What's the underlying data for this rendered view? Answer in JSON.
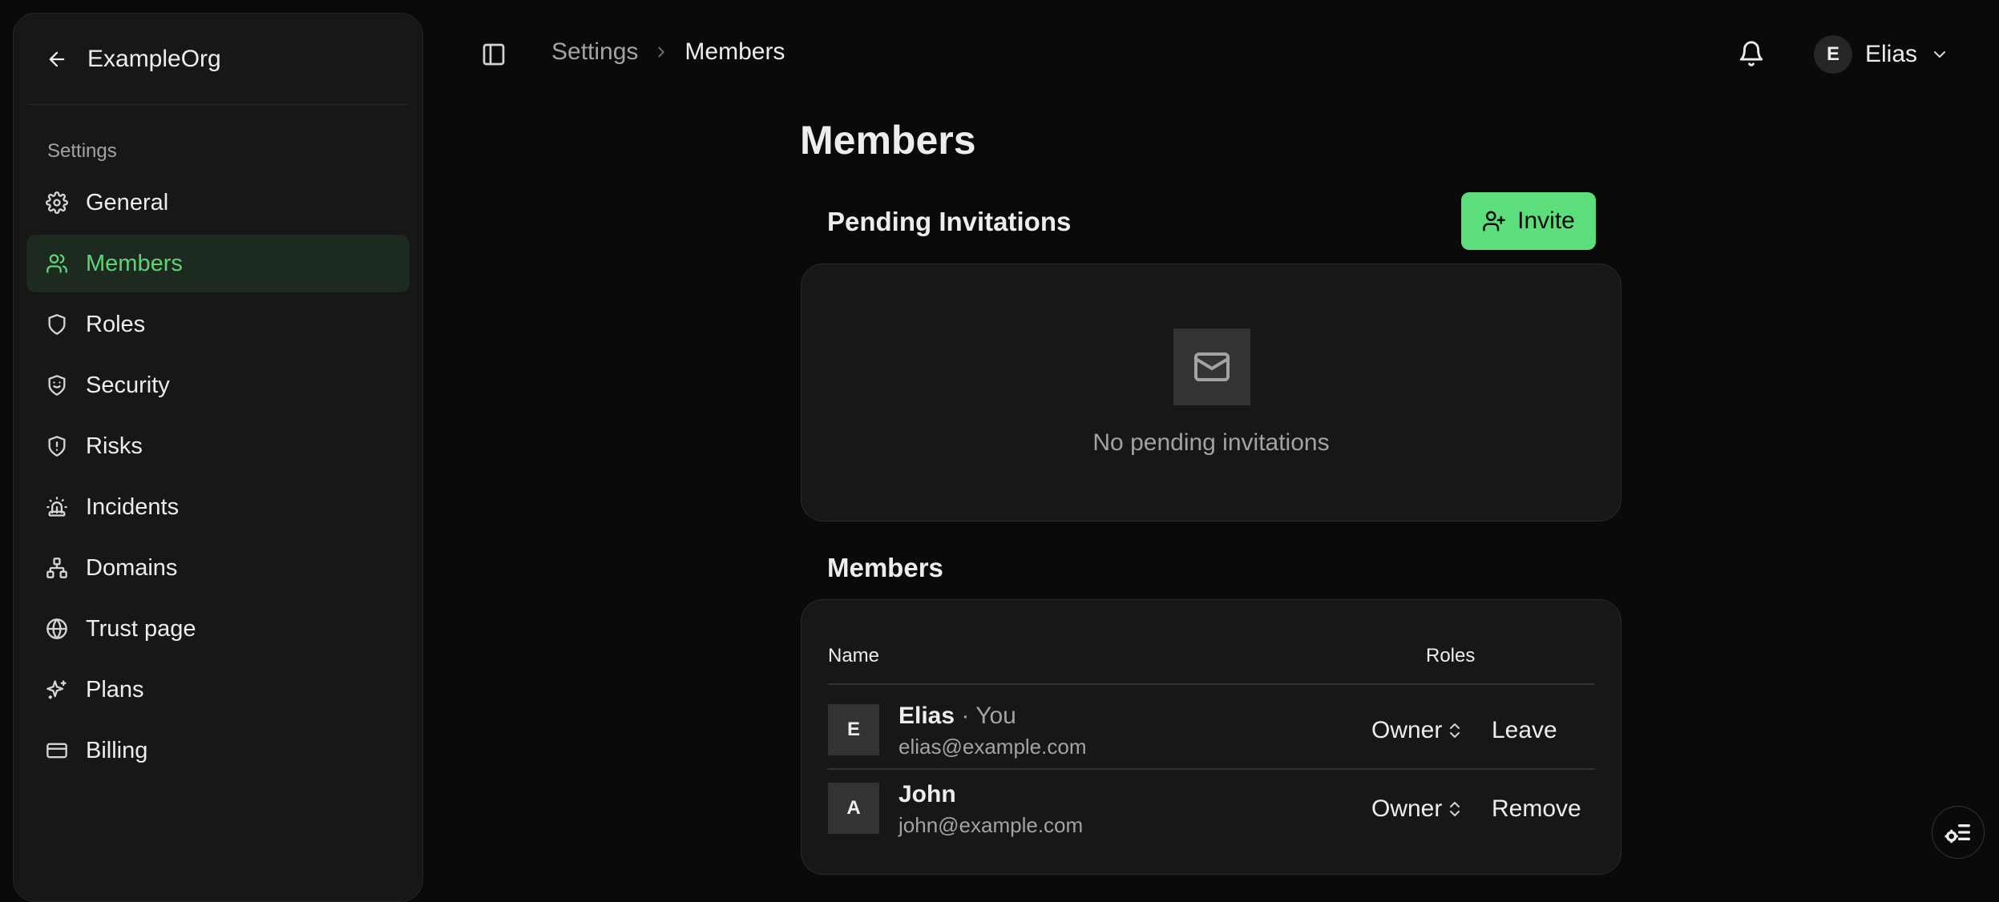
{
  "sidebar": {
    "org_name": "ExampleOrg",
    "section_label": "Settings",
    "items": [
      {
        "label": "General",
        "icon": "gear-icon"
      },
      {
        "label": "Members",
        "icon": "users-icon",
        "active": true
      },
      {
        "label": "Roles",
        "icon": "shield-icon"
      },
      {
        "label": "Security",
        "icon": "shield-smile-icon"
      },
      {
        "label": "Risks",
        "icon": "shield-alert-icon"
      },
      {
        "label": "Incidents",
        "icon": "siren-icon"
      },
      {
        "label": "Domains",
        "icon": "network-icon"
      },
      {
        "label": "Trust page",
        "icon": "globe-icon"
      },
      {
        "label": "Plans",
        "icon": "sparkles-icon"
      },
      {
        "label": "Billing",
        "icon": "credit-card-icon"
      }
    ]
  },
  "header": {
    "breadcrumb": [
      "Settings",
      "Members"
    ],
    "user": {
      "initial": "E",
      "name": "Elias"
    }
  },
  "main": {
    "title": "Members",
    "pending": {
      "title": "Pending Invitations",
      "invite_label": "Invite",
      "empty_text": "No pending invitations"
    },
    "members": {
      "title": "Members",
      "columns": {
        "name": "Name",
        "roles": "Roles"
      },
      "rows": [
        {
          "initial": "E",
          "name": "Elias",
          "suffix": "· You",
          "email": "elias@example.com",
          "role": "Owner",
          "action": "Leave"
        },
        {
          "initial": "A",
          "name": "John",
          "suffix": "",
          "email": "john@example.com",
          "role": "Owner",
          "action": "Remove"
        }
      ]
    }
  },
  "colors": {
    "accent": "#5dde7c",
    "background": "#0a0a0a",
    "panel": "#171717"
  }
}
